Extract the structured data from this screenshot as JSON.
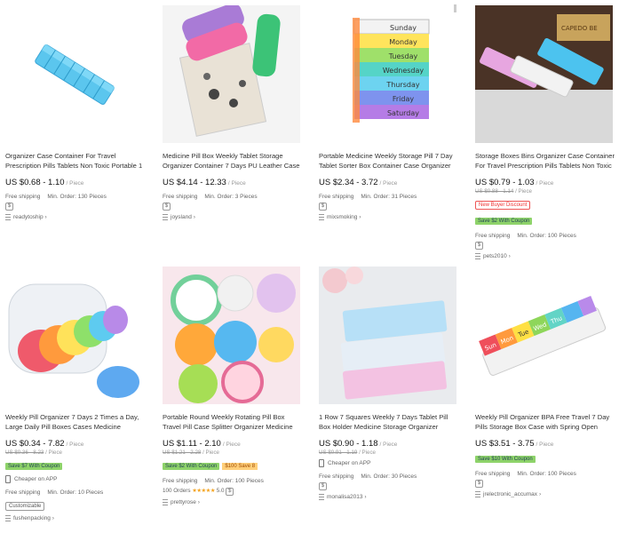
{
  "products": [
    {
      "title": "Organizer Case Container For Travel Prescription Pills Tablets Non Toxic Portable 1",
      "price": "US $0.68 - 1.10",
      "unit": "/ Piece",
      "shipping": "Free shipping",
      "min_order": "Min. Order: 130 Pieces",
      "store": "readytoship"
    },
    {
      "title": "Medicine Pill Box Weekly Tablet Storage Organizer Container 7 Days PU Leather Case",
      "price": "US $4.14 - 12.33",
      "unit": "/ Piece",
      "shipping": "Free shipping",
      "min_order": "Min. Order: 3 Pieces",
      "store": "joysland"
    },
    {
      "title": "Portable Medicine Weekly Storage Pill 7 Day Tablet Sorter Box Container Case Organizer",
      "price": "US $2.34 - 3.72",
      "unit": "/ Piece",
      "shipping": "Free shipping",
      "min_order": "Min. Order: 31 Pieces",
      "store": "mixsmoking"
    },
    {
      "title": "Storage Boxes Bins Organizer Case Container For Travel Prescription Pills Tablets Non Toxic",
      "price": "US $0.79 - 1.03",
      "unit": "/ Piece",
      "old_price": "US $0.88 - 1.14",
      "old_unit": "/ Piece",
      "tag_buyer": "New Buyer Discount",
      "tag_coupon": "Save $2 With Coupon",
      "shipping": "Free shipping",
      "min_order": "Min. Order: 100 Pieces",
      "store": "pets2010"
    },
    {
      "title": "Weekly Pill Organizer 7 Days 2 Times a Day, Large Daily Pill Boxes Cases Medicine",
      "price": "US $0.34 - 7.82",
      "unit": "/ Piece",
      "old_price": "US $0.36 - 8.23",
      "old_unit": "/ Piece",
      "tag_coupon": "Save $7 With Coupon",
      "app": "Cheaper on APP",
      "shipping": "Free shipping",
      "min_order": "Min. Order: 10 Pieces",
      "tag_custom": "Customizable",
      "store": "fushenpacking"
    },
    {
      "title": "Portable Round Weekly Rotating Pill Box Travel Pill Case Splitter Organizer Medicine",
      "price": "US $1.11 - 2.10",
      "unit": "/ Piece",
      "old_price": "US $1.21 - 2.28",
      "old_unit": "/ Piece",
      "tag_coupon": "Save $2 With Coupon",
      "tag_save": "$100 Save 8",
      "shipping": "Free shipping",
      "min_order": "Min. Order: 100 Pieces",
      "orders": "100 Orders",
      "stars": "★★★★★",
      "rating": "5.0",
      "store": "prettyrose"
    },
    {
      "title": "1 Row 7 Squares Weekly 7 Days Tablet Pill Box Holder Medicine Storage Organizer",
      "price": "US $0.90 - 1.18",
      "unit": "/ Piece",
      "old_price": "US $0.91 - 1.19",
      "old_unit": "/ Piece",
      "app": "Cheaper on APP",
      "shipping": "Free shipping",
      "min_order": "Min. Order: 30 Pieces",
      "store": "monalisa2013"
    },
    {
      "title": "Weekly Pill Organizer BPA Free Travel 7 Day Pills Storage Box Case with Spring Open",
      "price": "US $3.51 - 3.75",
      "unit": "/ Piece",
      "tag_coupon": "Save $10 With Coupon",
      "shipping": "Free shipping",
      "min_order": "Min. Order: 100 Pieces",
      "store": "jrelectronic_accumax"
    }
  ],
  "img_text": {
    "p3_days": [
      "Sunday",
      "Monday",
      "Tuesday",
      "Wednesday",
      "Thursday",
      "Friday",
      "Saturday"
    ],
    "p4_sign": "CAPEDO BE",
    "p8_days": [
      "Sun",
      "Mon",
      "Tue",
      "Wed",
      "Thu"
    ]
  },
  "dollar_symbol": "$",
  "colors": {
    "coupon_green": "#8ed36a",
    "discount_red": "#e55555",
    "star_orange": "#f4a21c"
  }
}
